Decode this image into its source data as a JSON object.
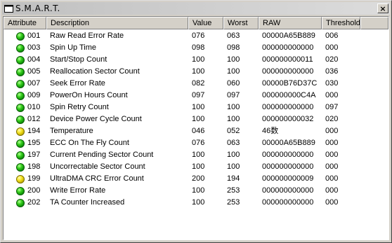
{
  "window": {
    "title": "S.M.A.R.T.",
    "close_label": "×"
  },
  "columns": {
    "attribute": "Attribute",
    "description": "Description",
    "value": "Value",
    "worst": "Worst",
    "raw": "RAW",
    "threshold": "Threshold"
  },
  "rows": [
    {
      "status": "green",
      "id": "001",
      "description": "Raw Read Error Rate",
      "value": "076",
      "worst": "063",
      "raw": "00000A65B889",
      "threshold": "006"
    },
    {
      "status": "green",
      "id": "003",
      "description": "Spin Up Time",
      "value": "098",
      "worst": "098",
      "raw": "000000000000",
      "threshold": "000"
    },
    {
      "status": "green",
      "id": "004",
      "description": "Start/Stop Count",
      "value": "100",
      "worst": "100",
      "raw": "000000000011",
      "threshold": "020"
    },
    {
      "status": "green",
      "id": "005",
      "description": "Reallocation Sector Count",
      "value": "100",
      "worst": "100",
      "raw": "000000000000",
      "threshold": "036"
    },
    {
      "status": "green",
      "id": "007",
      "description": "Seek Error Rate",
      "value": "082",
      "worst": "060",
      "raw": "00000B76D37C",
      "threshold": "030"
    },
    {
      "status": "green",
      "id": "009",
      "description": "PowerOn Hours Count",
      "value": "097",
      "worst": "097",
      "raw": "000000000C4A",
      "threshold": "000"
    },
    {
      "status": "green",
      "id": "010",
      "description": "Spin Retry Count",
      "value": "100",
      "worst": "100",
      "raw": "000000000000",
      "threshold": "097"
    },
    {
      "status": "green",
      "id": "012",
      "description": "Device Power Cycle Count",
      "value": "100",
      "worst": "100",
      "raw": "000000000032",
      "threshold": "020"
    },
    {
      "status": "yellow",
      "id": "194",
      "description": "Temperature",
      "value": "046",
      "worst": "052",
      "raw": "46数",
      "threshold": "000"
    },
    {
      "status": "green",
      "id": "195",
      "description": "ECC On The Fly Count",
      "value": "076",
      "worst": "063",
      "raw": "00000A65B889",
      "threshold": "000"
    },
    {
      "status": "green",
      "id": "197",
      "description": "Current Pending Sector Count",
      "value": "100",
      "worst": "100",
      "raw": "000000000000",
      "threshold": "000"
    },
    {
      "status": "green",
      "id": "198",
      "description": "Uncorrectable Sector Count",
      "value": "100",
      "worst": "100",
      "raw": "000000000000",
      "threshold": "000"
    },
    {
      "status": "yellow",
      "id": "199",
      "description": "UltraDMA CRC Error Count",
      "value": "200",
      "worst": "194",
      "raw": "000000000009",
      "threshold": "000"
    },
    {
      "status": "green",
      "id": "200",
      "description": "Write Error Rate",
      "value": "100",
      "worst": "253",
      "raw": "000000000000",
      "threshold": "000"
    },
    {
      "status": "green",
      "id": "202",
      "description": "TA Counter Increased",
      "value": "100",
      "worst": "253",
      "raw": "000000000000",
      "threshold": "000"
    }
  ],
  "colors": {
    "ok": "#19b50f",
    "warning": "#e6d200"
  },
  "icons": {
    "title": "window-app-icon",
    "close": "close-icon",
    "status_ok": "green-status-icon",
    "status_warning": "yellow-status-icon"
  }
}
